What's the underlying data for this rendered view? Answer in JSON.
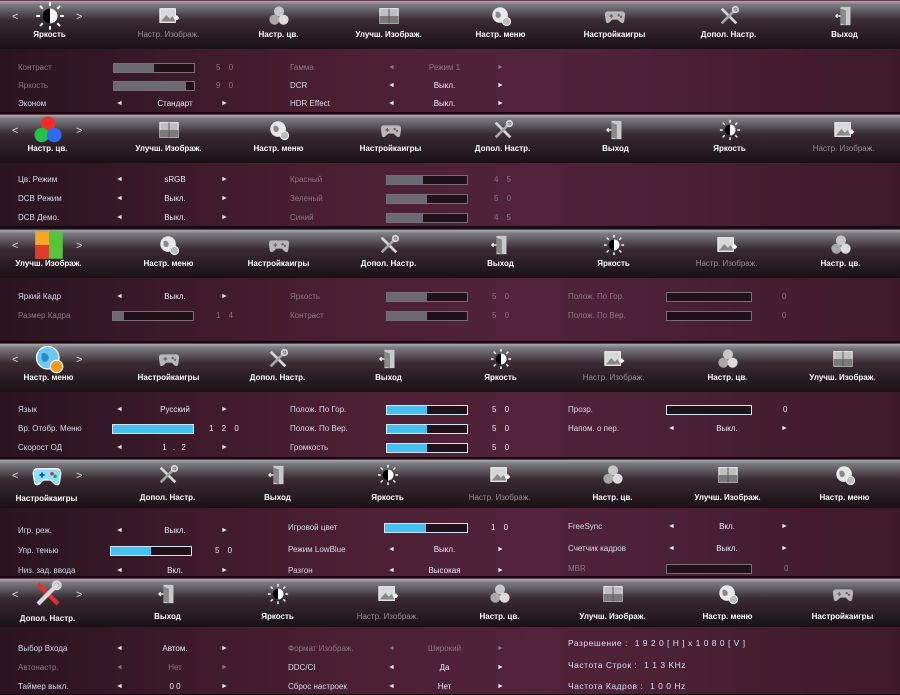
{
  "menu_items": {
    "brightness": "Яркость",
    "image_settings": "Настр. Изображ.",
    "color_settings": "Настр. цв.",
    "image_enhance": "Улучш. Изображ.",
    "menu_settings": "Настр. меню",
    "game_settings": "Настройкаигры",
    "extra_settings": "Допол. Настр.",
    "exit": "Выход"
  },
  "nav": {
    "left": "<",
    "right": ">"
  },
  "panel1": {
    "rows_left": [
      {
        "label": "Контраст",
        "value": "5 0",
        "level": 50
      },
      {
        "label": "Яркость",
        "value": "9 0",
        "level": 90
      },
      {
        "label": "Эконом",
        "value": "Стандарт"
      }
    ],
    "rows_right": [
      {
        "label": "Гамма",
        "value": "Режим 1"
      },
      {
        "label": "DCR",
        "value": "Выкл."
      },
      {
        "label": "HDR Effect",
        "value": "Выкл."
      }
    ]
  },
  "panel2": {
    "rows_left": [
      {
        "label": "Цв. Режим",
        "value": "sRGB"
      },
      {
        "label": "DCB Режим",
        "value": "Выкл."
      },
      {
        "label": "DCB Демо.",
        "value": "Выкл."
      }
    ],
    "rows_right": [
      {
        "label": "Красный",
        "value": "4 5",
        "level": 45
      },
      {
        "label": "Зеленый",
        "value": "5 0",
        "level": 50
      },
      {
        "label": "Синий",
        "value": "4 5",
        "level": 45
      }
    ]
  },
  "panel3": {
    "rows_left": [
      {
        "label": "Яркий Кадр",
        "value": "Выкл."
      },
      {
        "label": "Размер Кадра",
        "value": "1 4",
        "level": 14
      }
    ],
    "rows_mid": [
      {
        "label": "Яркость",
        "value": "5 0",
        "level": 50
      },
      {
        "label": "Контраст",
        "value": "5 0",
        "level": 50
      }
    ],
    "rows_right": [
      {
        "label": "Полож. По Гор.",
        "value": "0",
        "level": 0
      },
      {
        "label": "Полож. По Вер.",
        "value": "0",
        "level": 0
      }
    ]
  },
  "panel4": {
    "rows_left": [
      {
        "label": "Язык",
        "value": "Русский"
      },
      {
        "label": "Вр. Отобр. Меню",
        "value": "1 2 0",
        "level": 100
      },
      {
        "label": "Скорост ОД",
        "value": "1 . 2"
      }
    ],
    "rows_mid": [
      {
        "label": "Полож. По Гор.",
        "value": "5 0",
        "level": 50
      },
      {
        "label": "Полож. По Вер.",
        "value": "5 0",
        "level": 50
      },
      {
        "label": "Громкость",
        "value": "5 0",
        "level": 50
      }
    ],
    "rows_right": [
      {
        "label": "Прозр.",
        "value": "0",
        "level": 0
      },
      {
        "label": "Напом. о пер.",
        "value": "Выкл."
      }
    ]
  },
  "panel5": {
    "rows_left": [
      {
        "label": "Игр. реж.",
        "value": "Выкл."
      },
      {
        "label": "Упр. тенью",
        "value": "5 0",
        "level": 50
      },
      {
        "label": "Низ. зад. ввода",
        "value": "Вкл."
      }
    ],
    "rows_mid": [
      {
        "label": "Игровой цвет",
        "value": "1 0",
        "level": 50
      },
      {
        "label": "Режим LowBlue",
        "value": "Выкл."
      },
      {
        "label": "Разгон",
        "value": "Высокая"
      }
    ],
    "rows_right": [
      {
        "label": "FreeSync",
        "value": "Вкл."
      },
      {
        "label": "Счетчик кадров",
        "value": "Выкл."
      },
      {
        "label": "MBR",
        "value": "0",
        "level": 0
      }
    ]
  },
  "panel6": {
    "rows_left": [
      {
        "label": "Выбор Входа",
        "value": "Автом."
      },
      {
        "label": "Автонастр.",
        "value": "Нет"
      },
      {
        "label": "Таймер выкл.",
        "value": "0 0"
      }
    ],
    "rows_mid": [
      {
        "label": "Формат Изображ.",
        "value": "Широкий"
      },
      {
        "label": "DDC/CI",
        "value": "Да"
      },
      {
        "label": "Сброс настроек",
        "value": "Нет"
      }
    ],
    "info": {
      "resolution_label": "Разрешение :",
      "resolution_value": "1 9 2 0 [ H ] x 1 0 8 0 [ V ]",
      "hfreq_label": "Частота Строк :",
      "hfreq_value": "1 1 3 KHz",
      "vfreq_label": "Частота Кадров :",
      "vfreq_value": "1 0 0 Hz"
    }
  },
  "colors": {
    "accent_blue": "#46c0f0",
    "bar_gray": "#8e8e96",
    "panel": "#4c1f33"
  }
}
